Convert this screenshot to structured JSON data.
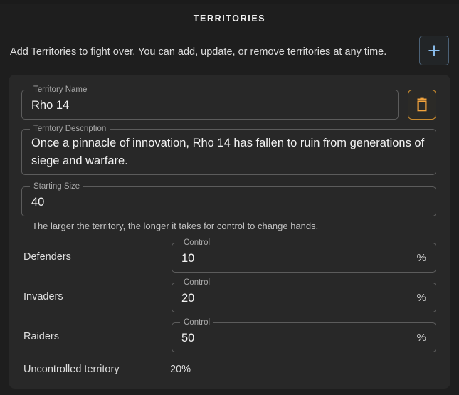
{
  "section": {
    "title": "TERRITORIES",
    "intro": "Add Territories to fight over. You can add, update, or remove territories at any time.",
    "add_button_label": "+",
    "add_icon": "plus-icon",
    "accent_blue": "#8cc0f0",
    "accent_orange": "#f2a33c"
  },
  "territory": {
    "name_label": "Territory Name",
    "name_value": "Rho 14",
    "description_label": "Territory Description",
    "description_value": "Once a pinnacle of innovation, Rho 14 has fallen to ruin from generations of siege and warfare.",
    "size_label": "Starting Size",
    "size_value": "40",
    "size_helper": "The larger the territory, the longer it takes for control to change hands.",
    "delete_icon": "trash-icon",
    "factions": [
      {
        "name": "Defenders",
        "control_label": "Control",
        "control_value": "10",
        "suffix": "%"
      },
      {
        "name": "Invaders",
        "control_label": "Control",
        "control_value": "20",
        "suffix": "%"
      },
      {
        "name": "Raiders",
        "control_label": "Control",
        "control_value": "50",
        "suffix": "%"
      }
    ],
    "uncontrolled_label": "Uncontrolled territory",
    "uncontrolled_value": "20%"
  }
}
